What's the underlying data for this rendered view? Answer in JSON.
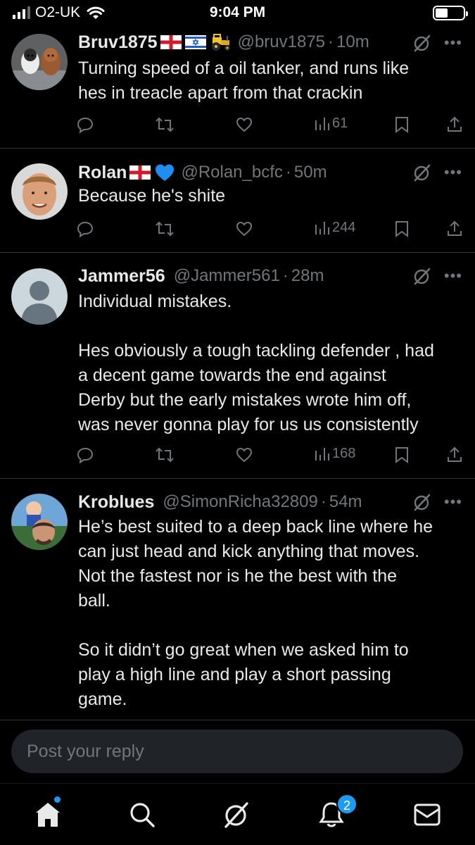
{
  "status_bar": {
    "carrier": "O2-UK",
    "time": "9:04 PM"
  },
  "tweets": [
    {
      "name": "Bruv1875",
      "badges": [
        "england-flag-icon",
        "israel-flag-icon",
        "tractor-emoji-icon"
      ],
      "handle": "@bruv1875",
      "time": "10m",
      "lines": [
        "Turning speed of a oil tanker, and runs like",
        "hes in treacle apart from that crackin"
      ],
      "views": "61"
    },
    {
      "name": "Rolan",
      "badges": [
        "england-flag-icon",
        "blue-heart-icon"
      ],
      "handle": "@Rolan_bcfc",
      "time": "50m",
      "lines": [
        "Because he's shite"
      ],
      "views": "244"
    },
    {
      "name": "Jammer56",
      "badges": [],
      "handle": "@Jammer561",
      "time": "28m",
      "lines": [
        "Individual mistakes.",
        "",
        "Hes obviously a tough tackling defender , had",
        "a decent game towards the end against",
        "Derby but the early mistakes wrote him off,",
        "was never gonna play for us us consistently"
      ],
      "views": "168"
    },
    {
      "name": "Kroblues",
      "badges": [],
      "handle": "@SimonRicha32809",
      "time": "54m",
      "lines": [
        "He’s best suited to a deep back line where he",
        "can just head and kick anything that moves.",
        "Not the fastest nor is he the best with the",
        "ball.",
        "",
        "So it didn’t go great when we asked him to",
        "play a high line and play a short passing",
        "game."
      ],
      "views": ""
    }
  ],
  "separator": "·",
  "more": "•••",
  "reply": {
    "placeholder": "Post your reply"
  },
  "bottom_nav": {
    "items": [
      "home-icon",
      "search-icon",
      "grok-icon",
      "notifications-icon",
      "messages-icon"
    ],
    "notifications_badge": "2"
  },
  "colors": {
    "background": "#000000",
    "text": "#e7e9ea",
    "muted": "#71767b",
    "accent": "#1d9bf0",
    "divider": "#2f3336"
  }
}
